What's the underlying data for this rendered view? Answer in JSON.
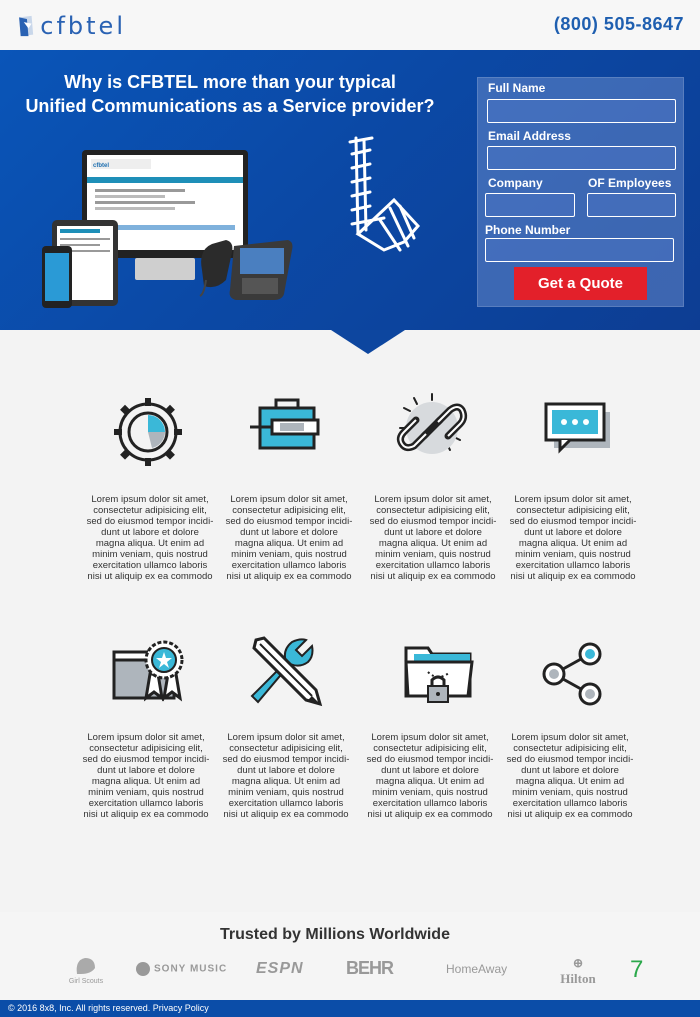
{
  "header": {
    "logo_text": "cfbtel",
    "phone": "(800) 505-8647"
  },
  "hero": {
    "title_line1": "Why is CFBTEL more than your typical",
    "title_line2": "Unified Communications as a Service provider?",
    "monitor_brand": "cfbtel"
  },
  "form": {
    "full_name_label": "Full Name",
    "email_label": "Email Address",
    "company_label": "Company",
    "employees_label": "OF Employees",
    "phone_label": "Phone Number",
    "submit_label": "Get a Quote"
  },
  "features": [
    {
      "icon": "gear-chart-icon",
      "text": "Lorem ipsum dolor sit amet, consectetur adipisicing elit, sed do eiusmod tempor incidi-dunt ut labore et dolore magna aliqua. Ut enim ad minim veniam, quis nostrud exercitation ullamco laboris nisi ut aliquip ex ea commodo"
    },
    {
      "icon": "toolbox-icon",
      "text": "Lorem ipsum dolor sit amet, consectetur adipisicing elit, sed do eiusmod tempor incidi-dunt ut labore et dolore magna aliqua. Ut enim ad minim veniam, quis nostrud exercitation ullamco laboris nisi ut aliquip ex ea commodo"
    },
    {
      "icon": "chain-link-icon",
      "text": "Lorem ipsum dolor sit amet, consectetur adipisicing elit, sed do eiusmod tempor incidi-dunt ut labore et dolore magna aliqua. Ut enim ad minim veniam, quis nostrud exercitation ullamco laboris nisi ut aliquip ex ea commodo"
    },
    {
      "icon": "chat-bubble-icon",
      "text": "Lorem ipsum dolor sit amet, consectetur adipisicing elit, sed do eiusmod tempor incidi-dunt ut labore et dolore magna aliqua. Ut enim ad minim veniam, quis nostrud exercitation ullamco laboris nisi ut aliquip ex ea commodo"
    },
    {
      "icon": "certificate-icon",
      "text": "Lorem ipsum dolor sit amet, consectetur adipisicing elit, sed do eiusmod tempor incidi-dunt ut labore et dolore magna aliqua. Ut enim ad minim veniam, quis nostrud exercitation ullamco laboris nisi ut aliquip ex ea commodo"
    },
    {
      "icon": "wrench-pencil-icon",
      "text": "Lorem ipsum dolor sit amet, consectetur adipisicing elit, sed do eiusmod tempor incidi-dunt ut labore et dolore magna aliqua. Ut enim ad minim veniam, quis nostrud exercitation ullamco laboris nisi ut aliquip ex ea commodo"
    },
    {
      "icon": "locked-folder-icon",
      "text": "Lorem ipsum dolor sit amet, consectetur adipisicing elit, sed do eiusmod tempor incidi-dunt ut labore et dolore magna aliqua. Ut enim ad minim veniam, quis nostrud exercitation ullamco laboris nisi ut aliquip ex ea commodo"
    },
    {
      "icon": "share-icon",
      "text": "Lorem ipsum dolor sit amet, consectetur adipisicing elit, sed do eiusmod tempor incidi-dunt ut labore et dolore magna aliqua. Ut enim ad minim veniam, quis nostrud exercitation ullamco laboris nisi ut aliquip ex ea commodo"
    }
  ],
  "trusted": {
    "title": "Trusted by Millions Worldwide",
    "brands": [
      "Girl Scouts",
      "SONY MUSIC",
      "ESPN",
      "BEHR",
      "HomeAway",
      "Hilton",
      "7"
    ]
  },
  "footer": {
    "text": "© 2016 8x8, Inc. All rights reserved. Privacy Policy"
  },
  "colors": {
    "brand_blue": "#1f5fb0",
    "hero_blue": "#0b49a6",
    "accent_cyan": "#3ab8d8",
    "button_red": "#e3202a"
  }
}
